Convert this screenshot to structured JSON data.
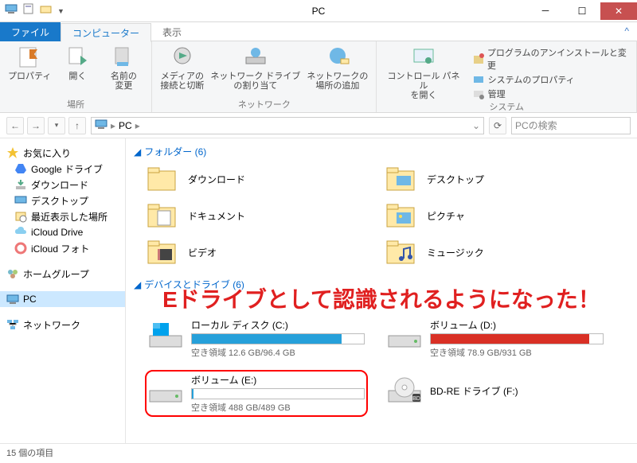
{
  "title": "PC",
  "tabs": {
    "file": "ファイル",
    "computer": "コンピューター",
    "view": "表示"
  },
  "ribbon": {
    "location": {
      "properties": "プロパティ",
      "open": "開く",
      "rename": "名前の\n変更",
      "label": "場所"
    },
    "network": {
      "media": "メディアの\n接続と切断",
      "mapdrive": "ネットワーク ドライブ\nの割り当て",
      "addloc": "ネットワークの\n場所の追加",
      "label": "ネットワーク"
    },
    "system": {
      "cpanel": "コントロール パネル\nを開く",
      "uninstall": "プログラムのアンインストールと変更",
      "sysprop": "システムのプロパティ",
      "manage": "管理",
      "label": "システム"
    }
  },
  "breadcrumb": "PC",
  "search_placeholder": "PCの検索",
  "tree": {
    "fav": "お気に入り",
    "gdrive": "Google ドライブ",
    "dl": "ダウンロード",
    "desktop": "デスクトップ",
    "recent": "最近表示した場所",
    "idrive": "iCloud Drive",
    "iphoto": "iCloud フォト",
    "homegroup": "ホームグループ",
    "pc": "PC",
    "net": "ネットワーク"
  },
  "folders": {
    "head": "フォルダー (6)",
    "dl": "ダウンロード",
    "desktop": "デスクトップ",
    "docs": "ドキュメント",
    "pics": "ピクチャ",
    "vids": "ビデオ",
    "music": "ミュージック"
  },
  "drives": {
    "head": "デバイスとドライブ (6)",
    "c": {
      "name": "ローカル ディスク (C:)",
      "free": "空き領域 12.6 GB/96.4 GB",
      "fill": 87,
      "color": "#26a0da"
    },
    "d": {
      "name": "ボリューム (D:)",
      "free": "空き領域 78.9 GB/931 GB",
      "fill": 92,
      "color": "#d93025"
    },
    "e": {
      "name": "ボリューム (E:)",
      "free": "空き領域 488 GB/489 GB",
      "fill": 1,
      "color": "#26a0da"
    },
    "f": {
      "name": "BD-RE ドライブ (F:)"
    }
  },
  "annotation": "Eドライブとして認識されるようになった！",
  "status": "15 個の項目"
}
